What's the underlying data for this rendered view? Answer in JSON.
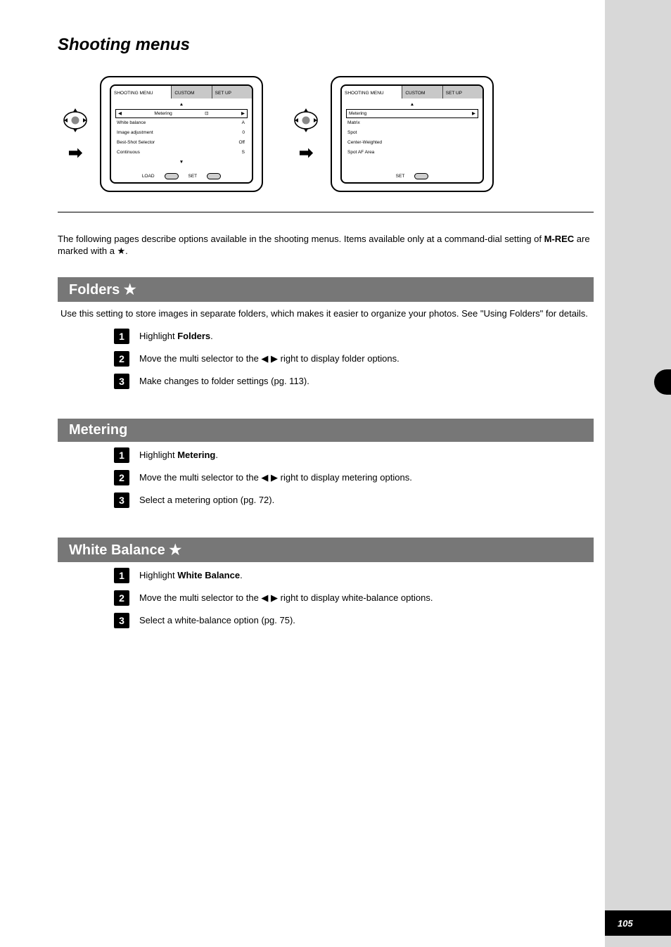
{
  "page_title": "Shooting menus",
  "diagrams": {
    "left": {
      "tab_main": "SHOOTING MENU",
      "tab_sub1": "CUSTOM",
      "tab_sub2": "SET UP",
      "navUp": "▲",
      "navDown": "▼",
      "selected_label": "Metering",
      "selected_icon": "⊡",
      "rows": [
        {
          "label": "White balance",
          "value": "A"
        },
        {
          "label": "Image adjustment",
          "value": "0"
        },
        {
          "label": "Best-Shot Selector",
          "value": "Off"
        },
        {
          "label": "Continuous",
          "value": "S"
        }
      ],
      "footer_load": "LOAD",
      "footer_set": "SET"
    },
    "right": {
      "tab_main": "SHOOTING MENU",
      "tab_sub1": "CUSTOM",
      "tab_sub2": "SET UP",
      "navUp": "▲",
      "selected_label": "Metering",
      "options": [
        "Matrix",
        "Spot",
        "Center-Weighted",
        "Spot AF Area"
      ],
      "footer_set": "SET"
    }
  },
  "intro_part1": "The following pages describe options available in the shooting menus. Items available only at a command-dial setting of ",
  "intro_bold": "M-REC",
  "intro_part2": " are marked with a ★.",
  "sections": [
    {
      "title": "Folders ★",
      "desc": "Use this setting to store images in separate folders, which makes it easier to organize your photos. See \"Using Folders\" for details.",
      "steps": [
        {
          "n": "1",
          "text_prefix": "Highlight ",
          "opt": "Folders",
          "text_suffix": "."
        },
        {
          "n": "2",
          "text_prefix": "Move the multi selector to the ",
          "arrows": "◀ ▶",
          "text_suffix": " right to display folder options."
        },
        {
          "n": "3",
          "text_prefix": "Make changes to folder settings (",
          "ref": "pg. 113",
          "text_suffix": ")."
        }
      ]
    },
    {
      "title": "Metering",
      "desc": "",
      "steps": [
        {
          "n": "1",
          "text_prefix": "Highlight ",
          "opt": "Metering",
          "text_suffix": "."
        },
        {
          "n": "2",
          "text_prefix": "Move the multi selector to the ",
          "arrows": "◀ ▶",
          "text_suffix": " right to display metering options."
        },
        {
          "n": "3",
          "text_prefix": "Select a metering option (",
          "ref": "pg. 72",
          "text_suffix": ")."
        }
      ]
    },
    {
      "title": "White Balance ★",
      "desc": "",
      "steps": [
        {
          "n": "1",
          "text_prefix": "Highlight ",
          "opt": "White Balance",
          "text_suffix": "."
        },
        {
          "n": "2",
          "text_prefix": "Move the multi selector to the ",
          "arrows": "◀ ▶",
          "text_suffix": " right to display white-balance options."
        },
        {
          "n": "3",
          "text_prefix": "Select a white-balance option (",
          "ref": "pg. 75",
          "text_suffix": ")."
        }
      ]
    }
  ],
  "page_number": "105"
}
